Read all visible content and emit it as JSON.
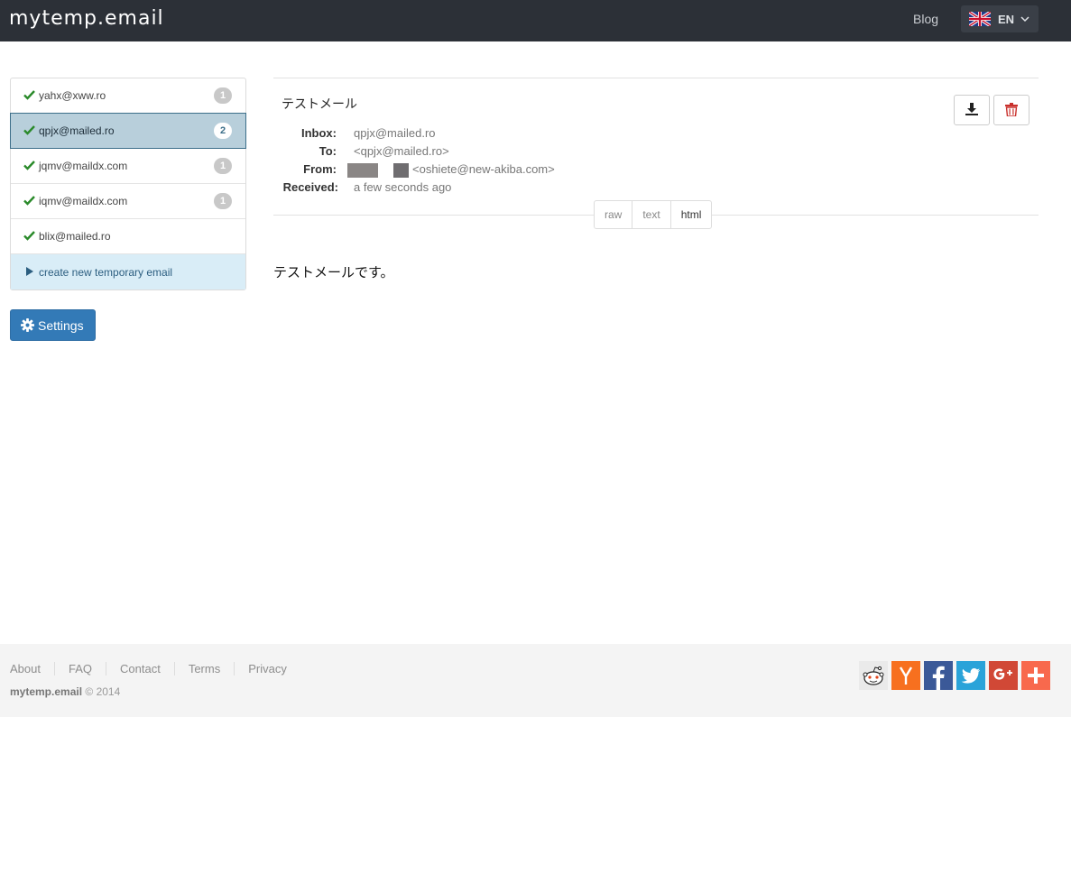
{
  "header": {
    "brand": "mytemp.email",
    "blog_label": "Blog",
    "language": "EN"
  },
  "inboxes": [
    {
      "address": "yahx@xww.ro",
      "count": "1",
      "active": false
    },
    {
      "address": "qpjx@mailed.ro",
      "count": "2",
      "active": true
    },
    {
      "address": "jqmv@maildx.com",
      "count": "1",
      "active": false
    },
    {
      "address": "iqmv@maildx.com",
      "count": "1",
      "active": false
    },
    {
      "address": "blix@mailed.ro",
      "count": "",
      "active": false
    }
  ],
  "create_label": "create new temporary email",
  "settings_label": "Settings",
  "message": {
    "subject": "テストメール",
    "inbox_label": "Inbox:",
    "inbox": "qpjx@mailed.ro",
    "to_label": "To:",
    "to": "<qpjx@mailed.ro>",
    "from_label": "From:",
    "from": "<oshiete@new-akiba.com>",
    "received_label": "Received:",
    "received": "a few seconds ago",
    "body": "テストメールです。"
  },
  "view_tabs": [
    "raw",
    "text",
    "html"
  ],
  "footer": {
    "links": [
      "About",
      "FAQ",
      "Contact",
      "Terms",
      "Privacy"
    ],
    "brand": "mytemp.email",
    "copyright": "© 2014"
  },
  "social": [
    "reddit-icon",
    "hackernews-icon",
    "facebook-icon",
    "twitter-icon",
    "googleplus-icon",
    "addthis-icon"
  ],
  "colors": {
    "topbar": "#2c3037",
    "primary": "#337ab7",
    "active_row": "#b8cfdb",
    "create_row": "#d9edf7",
    "check": "#2a8a2a"
  }
}
